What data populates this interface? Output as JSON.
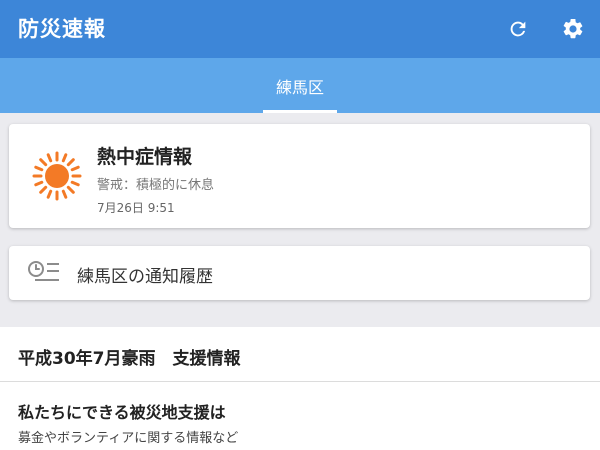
{
  "appbar": {
    "title": "防災速報",
    "refresh_icon": "refresh-icon",
    "settings_icon": "gear-icon"
  },
  "tabs": [
    {
      "label": "練馬区",
      "selected": true
    }
  ],
  "alert": {
    "icon": "sun-icon",
    "title": "熱中症情報",
    "level": "警戒：積極的に休息",
    "time": "7月26日 9:51"
  },
  "history": {
    "icon": "history-list-icon",
    "label": "練馬区の通知履歴"
  },
  "support": {
    "header": "平成30年7月豪雨　支援情報",
    "items": [
      {
        "title": "私たちにできる被災地支援は",
        "subtitle": "募金やボランティアに関する情報など"
      }
    ]
  },
  "colors": {
    "appbar": "#3d86d8",
    "tabbar": "#5ea7ea",
    "sun": "#f37a26",
    "background": "#ebebef"
  }
}
